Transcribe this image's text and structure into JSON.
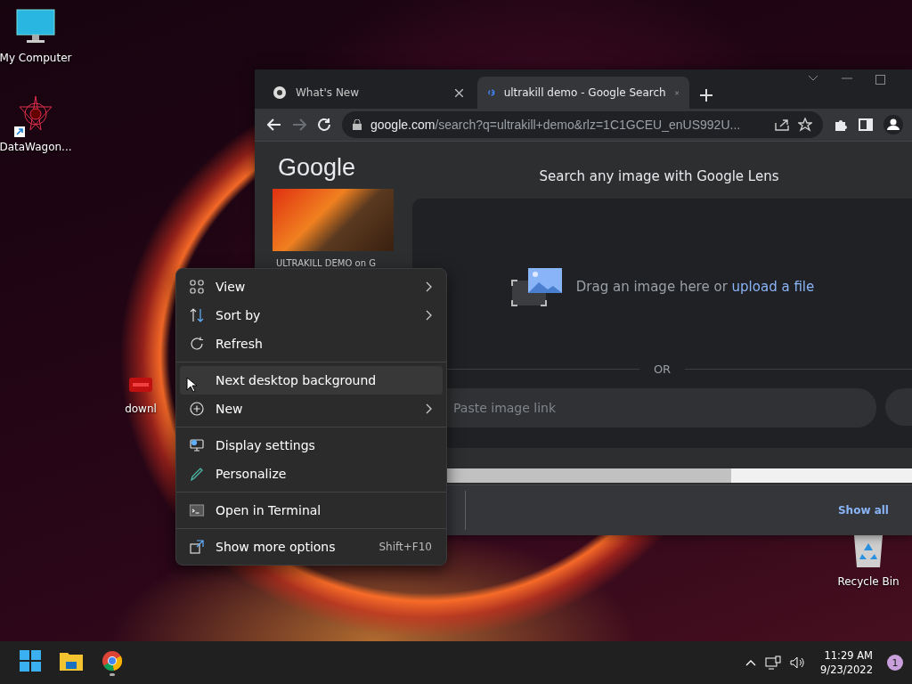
{
  "desktop_icons": [
    {
      "label": "My Computer",
      "shortcut": false
    },
    {
      "label": "DataWagon...",
      "shortcut": true
    },
    {
      "label": "downl",
      "shortcut": false
    },
    {
      "label": "Recycle Bin",
      "shortcut": false
    }
  ],
  "browser": {
    "tabs": [
      {
        "title": "What's New",
        "selected": false
      },
      {
        "title": "ultrakill demo - Google Search",
        "selected": true
      }
    ],
    "forward_disabled": true,
    "address": {
      "host": "google.com",
      "path": "/search?q=ultrakill+demo&rlz=1C1GCEU_enUS992U..."
    },
    "page": {
      "logo": "Google",
      "result_caption": "ULTRAKILL DEMO on G",
      "lens": {
        "title": "Search any image with Google Lens",
        "drop_text": "Drag an image here or ",
        "link": "upload a file",
        "separator": "OR",
        "placeholder": "Paste image link"
      },
      "downloads": {
        "show_all": "Show all"
      }
    }
  },
  "context_menu": {
    "groups": [
      [
        {
          "label": "View",
          "submenu": true,
          "selected": false
        },
        {
          "label": "Sort by",
          "submenu": true,
          "selected": false
        },
        {
          "label": "Refresh",
          "submenu": false,
          "selected": false
        }
      ],
      [
        {
          "label": "Next desktop background",
          "submenu": false,
          "selected": true
        },
        {
          "label": "New",
          "submenu": true,
          "selected": false
        }
      ],
      [
        {
          "label": "Display settings",
          "submenu": false,
          "selected": false
        },
        {
          "label": "Personalize",
          "submenu": false,
          "selected": false
        }
      ],
      [
        {
          "label": "Open in Terminal",
          "submenu": false,
          "selected": false
        }
      ],
      [
        {
          "label": "Show more options",
          "submenu": false,
          "shortcut": "Shift+F10",
          "selected": false
        }
      ]
    ]
  },
  "taskbar": {
    "apps": [
      {
        "running": false
      },
      {
        "running": false
      },
      {
        "running": true
      }
    ],
    "time": "11:29 AM",
    "date": "9/23/2022",
    "notifications": "1"
  }
}
